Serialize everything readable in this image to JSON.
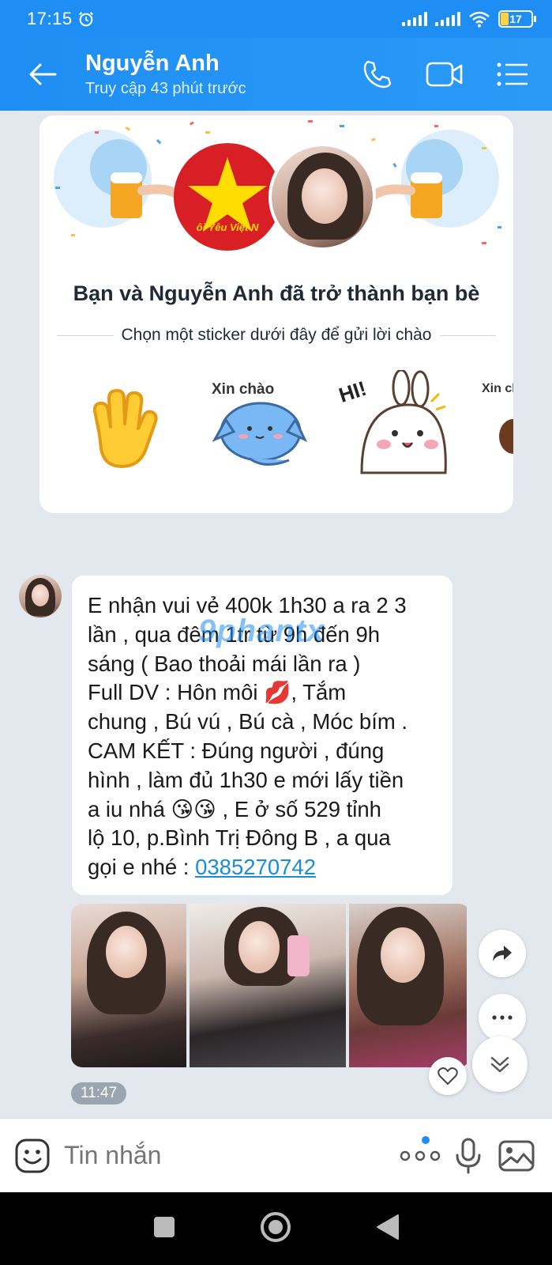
{
  "status_bar": {
    "time": "17:15",
    "battery": "17"
  },
  "header": {
    "contact_name": "Nguyễn Anh",
    "last_seen": "Truy cập 43 phút trước"
  },
  "friend_card": {
    "flag_caption": "ôi Yêu Việt N",
    "title": "Bạn và Nguyễn Anh đã trở thành bạn bè",
    "subtitle": "Chọn một sticker dưới đây để gửi lời chào",
    "stickers": [
      {
        "name": "waving-hand",
        "caption": ""
      },
      {
        "name": "blue-cat",
        "caption": "Xin chào"
      },
      {
        "name": "bunny-hi",
        "caption": "HI!"
      },
      {
        "name": "partial-sticker",
        "caption": "Xin chà"
      }
    ]
  },
  "message": {
    "text": "E nhận vui vẻ 400k 1h30 a ra 2 3\nlần , qua đêm 1tr từ 9h đến 9h\nsáng ( Bao thoải mái lần ra )\nFull DV : Hôn môi 💋, Tắm\nchung , Bú vú , Bú cà , Móc bím .\nCAM KẾT : Đúng người , đúng\nhình , làm đủ 1h30 e mới lấy tiền\na iu nhá 😘😘 , E ở số 529 tỉnh\nlộ 10, p.Bình Trị Đông B , a qua\ngọi e nhé : ",
    "phone": "0385270742",
    "watermark": "9phantx",
    "time": "11:47"
  },
  "input_bar": {
    "placeholder": "Tin nhắn"
  },
  "colors": {
    "accent": "#1f8ef4",
    "background": "#e3e8ee",
    "link": "#1a8cd8"
  }
}
